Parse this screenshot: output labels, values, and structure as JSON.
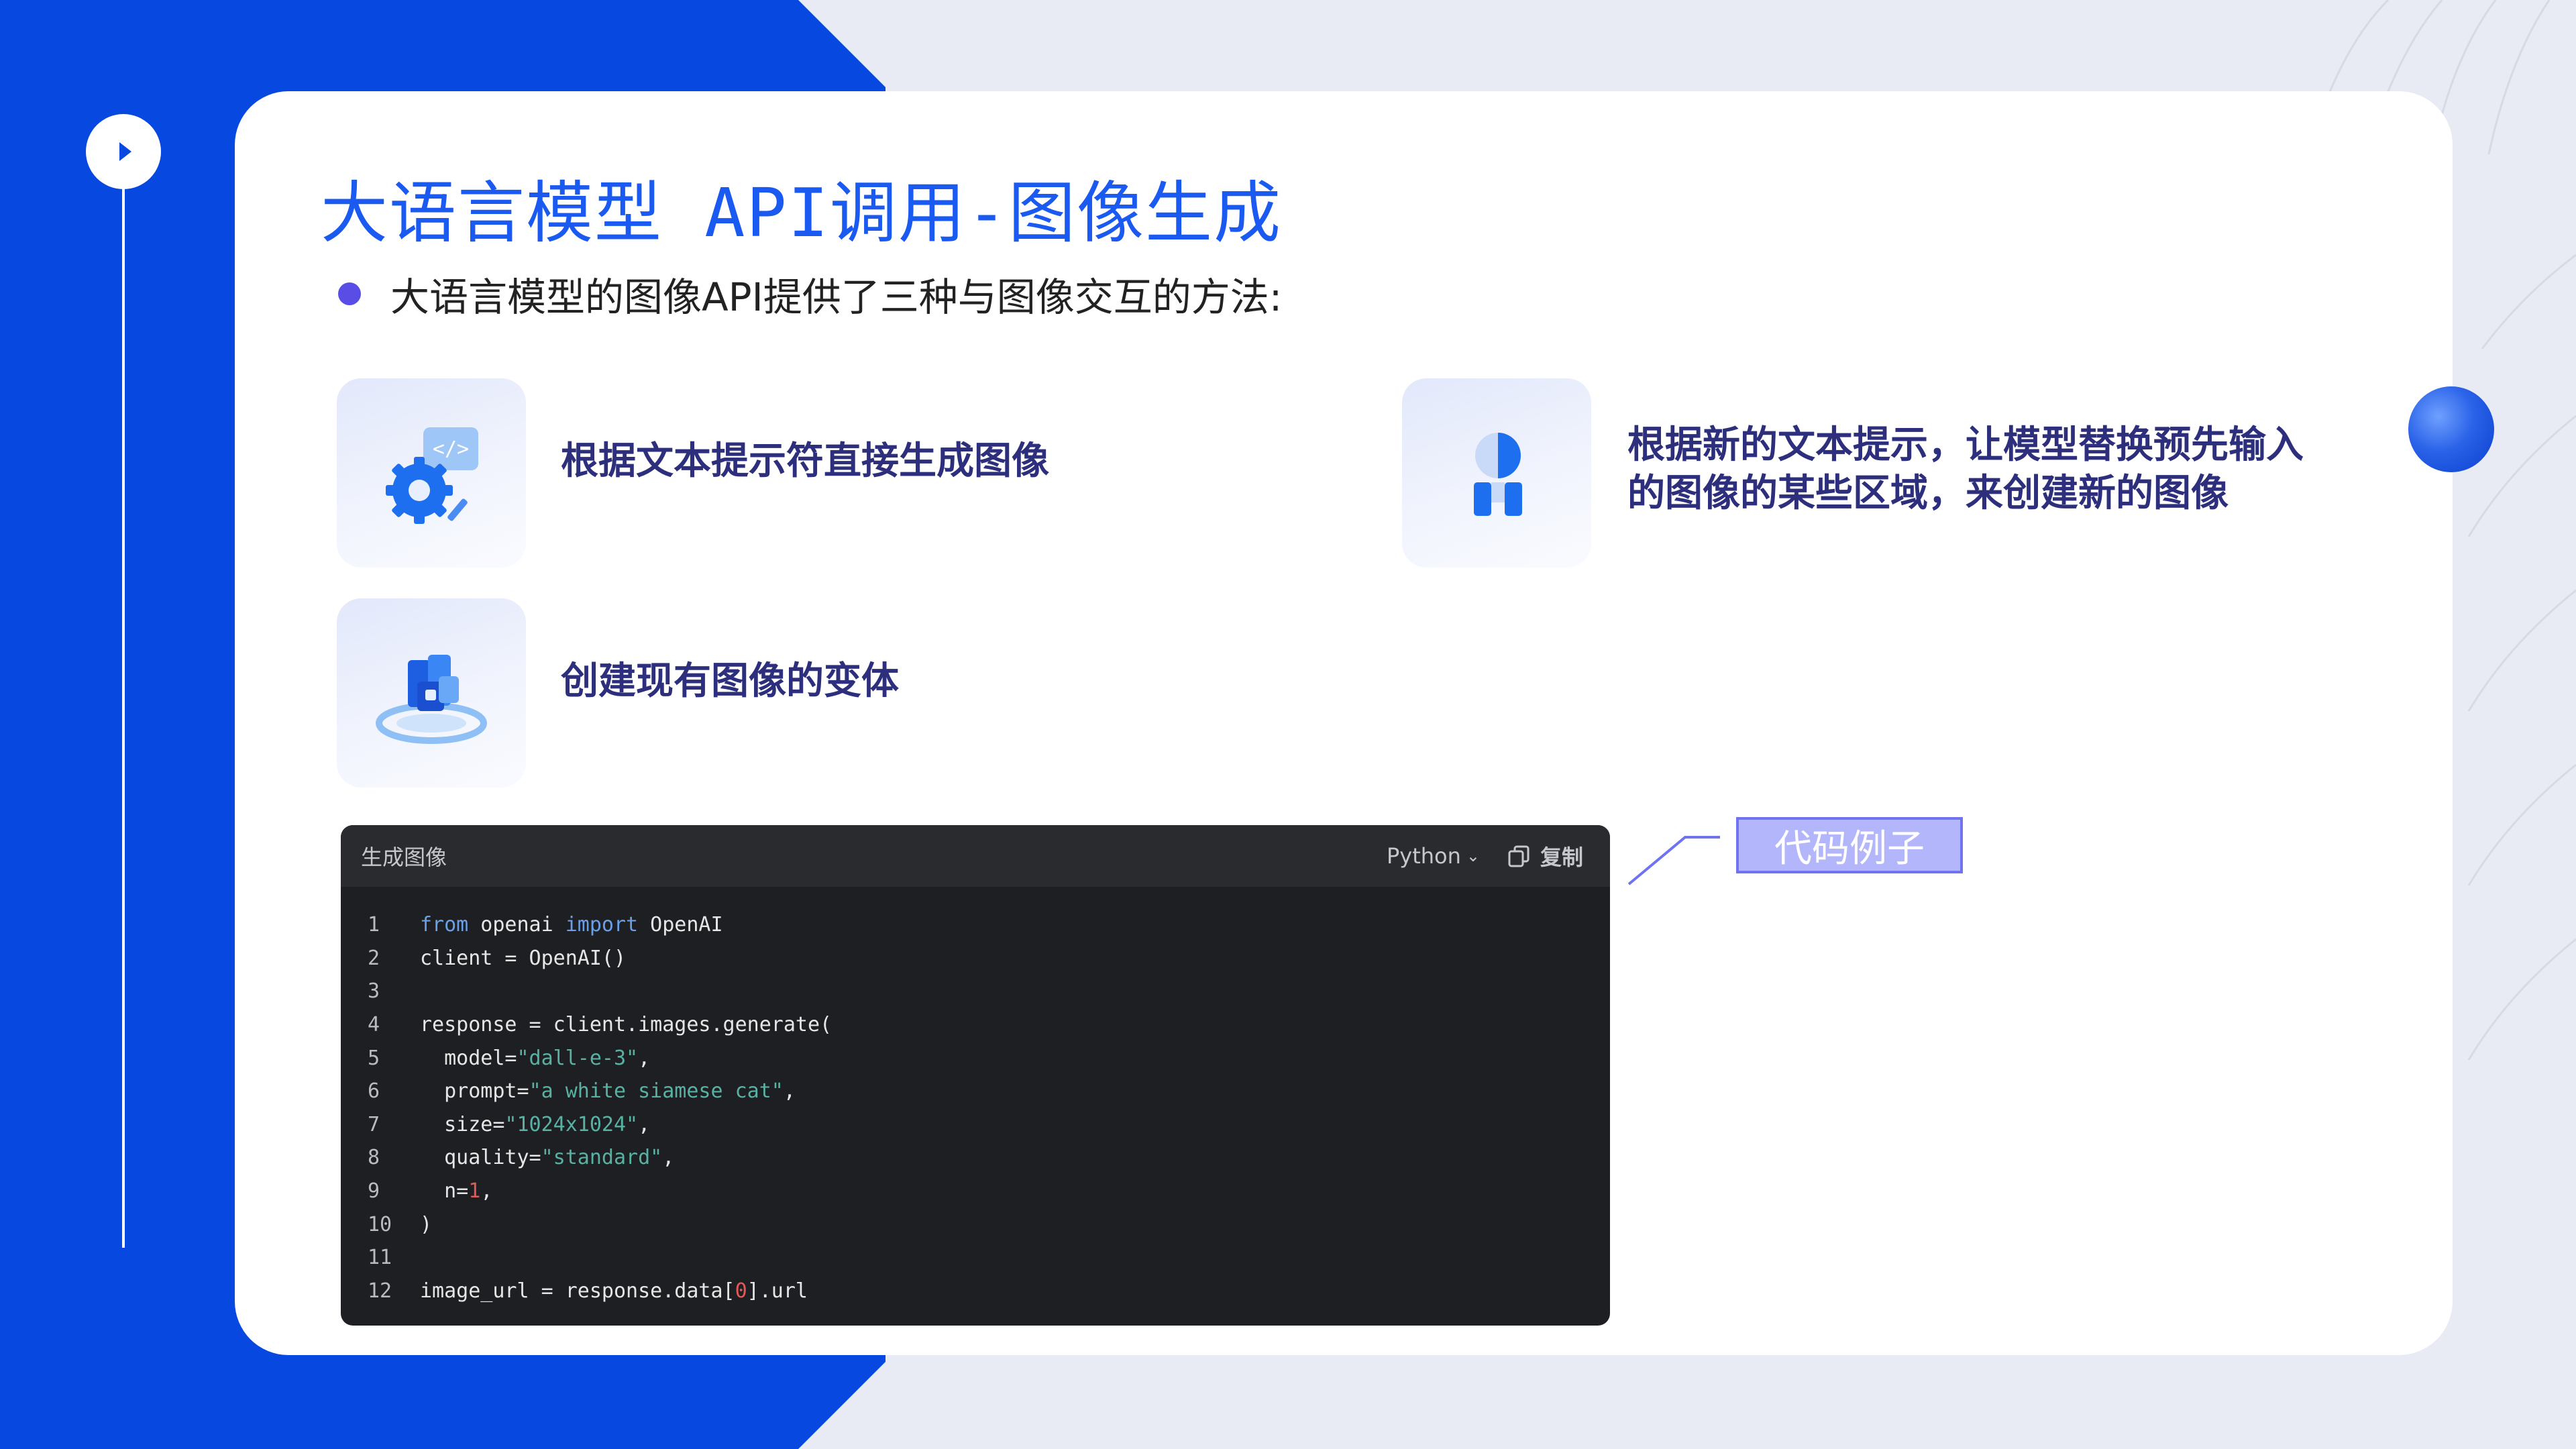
{
  "slide": {
    "title": "大语言模型 API调用-图像生成",
    "bullet": "大语言模型的图像API提供了三种与图像交互的方法:"
  },
  "features": [
    {
      "label": "根据文本提示符直接生成图像",
      "icon": "gear-code-icon"
    },
    {
      "label": "根据新的文本提示，让模型替换预先输入的图像的某些区域，来创建新的图像",
      "icon": "user-edit-icon"
    },
    {
      "label": "创建现有图像的变体",
      "icon": "cubes-stack-icon"
    }
  ],
  "code": {
    "title": "生成图像",
    "language": "Python",
    "copy_label": "复制",
    "lines": [
      {
        "n": "1",
        "text": "from openai import OpenAI"
      },
      {
        "n": "2",
        "text": "client = OpenAI()"
      },
      {
        "n": "3",
        "text": ""
      },
      {
        "n": "4",
        "text": "response = client.images.generate("
      },
      {
        "n": "5",
        "text": "  model=\"dall-e-3\","
      },
      {
        "n": "6",
        "text": "  prompt=\"a white siamese cat\","
      },
      {
        "n": "7",
        "text": "  size=\"1024x1024\","
      },
      {
        "n": "8",
        "text": "  quality=\"standard\","
      },
      {
        "n": "9",
        "text": "  n=1,"
      },
      {
        "n": "10",
        "text": ")"
      },
      {
        "n": "11",
        "text": ""
      },
      {
        "n": "12",
        "text": "image_url = response.data[0].url"
      }
    ]
  },
  "annotation": {
    "label": "代码例子"
  },
  "colors": {
    "brand_blue": "#0748e0",
    "title_blue": "#1a5af0",
    "feature_text": "#2d2f7c",
    "annotation_fill": "#b4b6fb"
  }
}
